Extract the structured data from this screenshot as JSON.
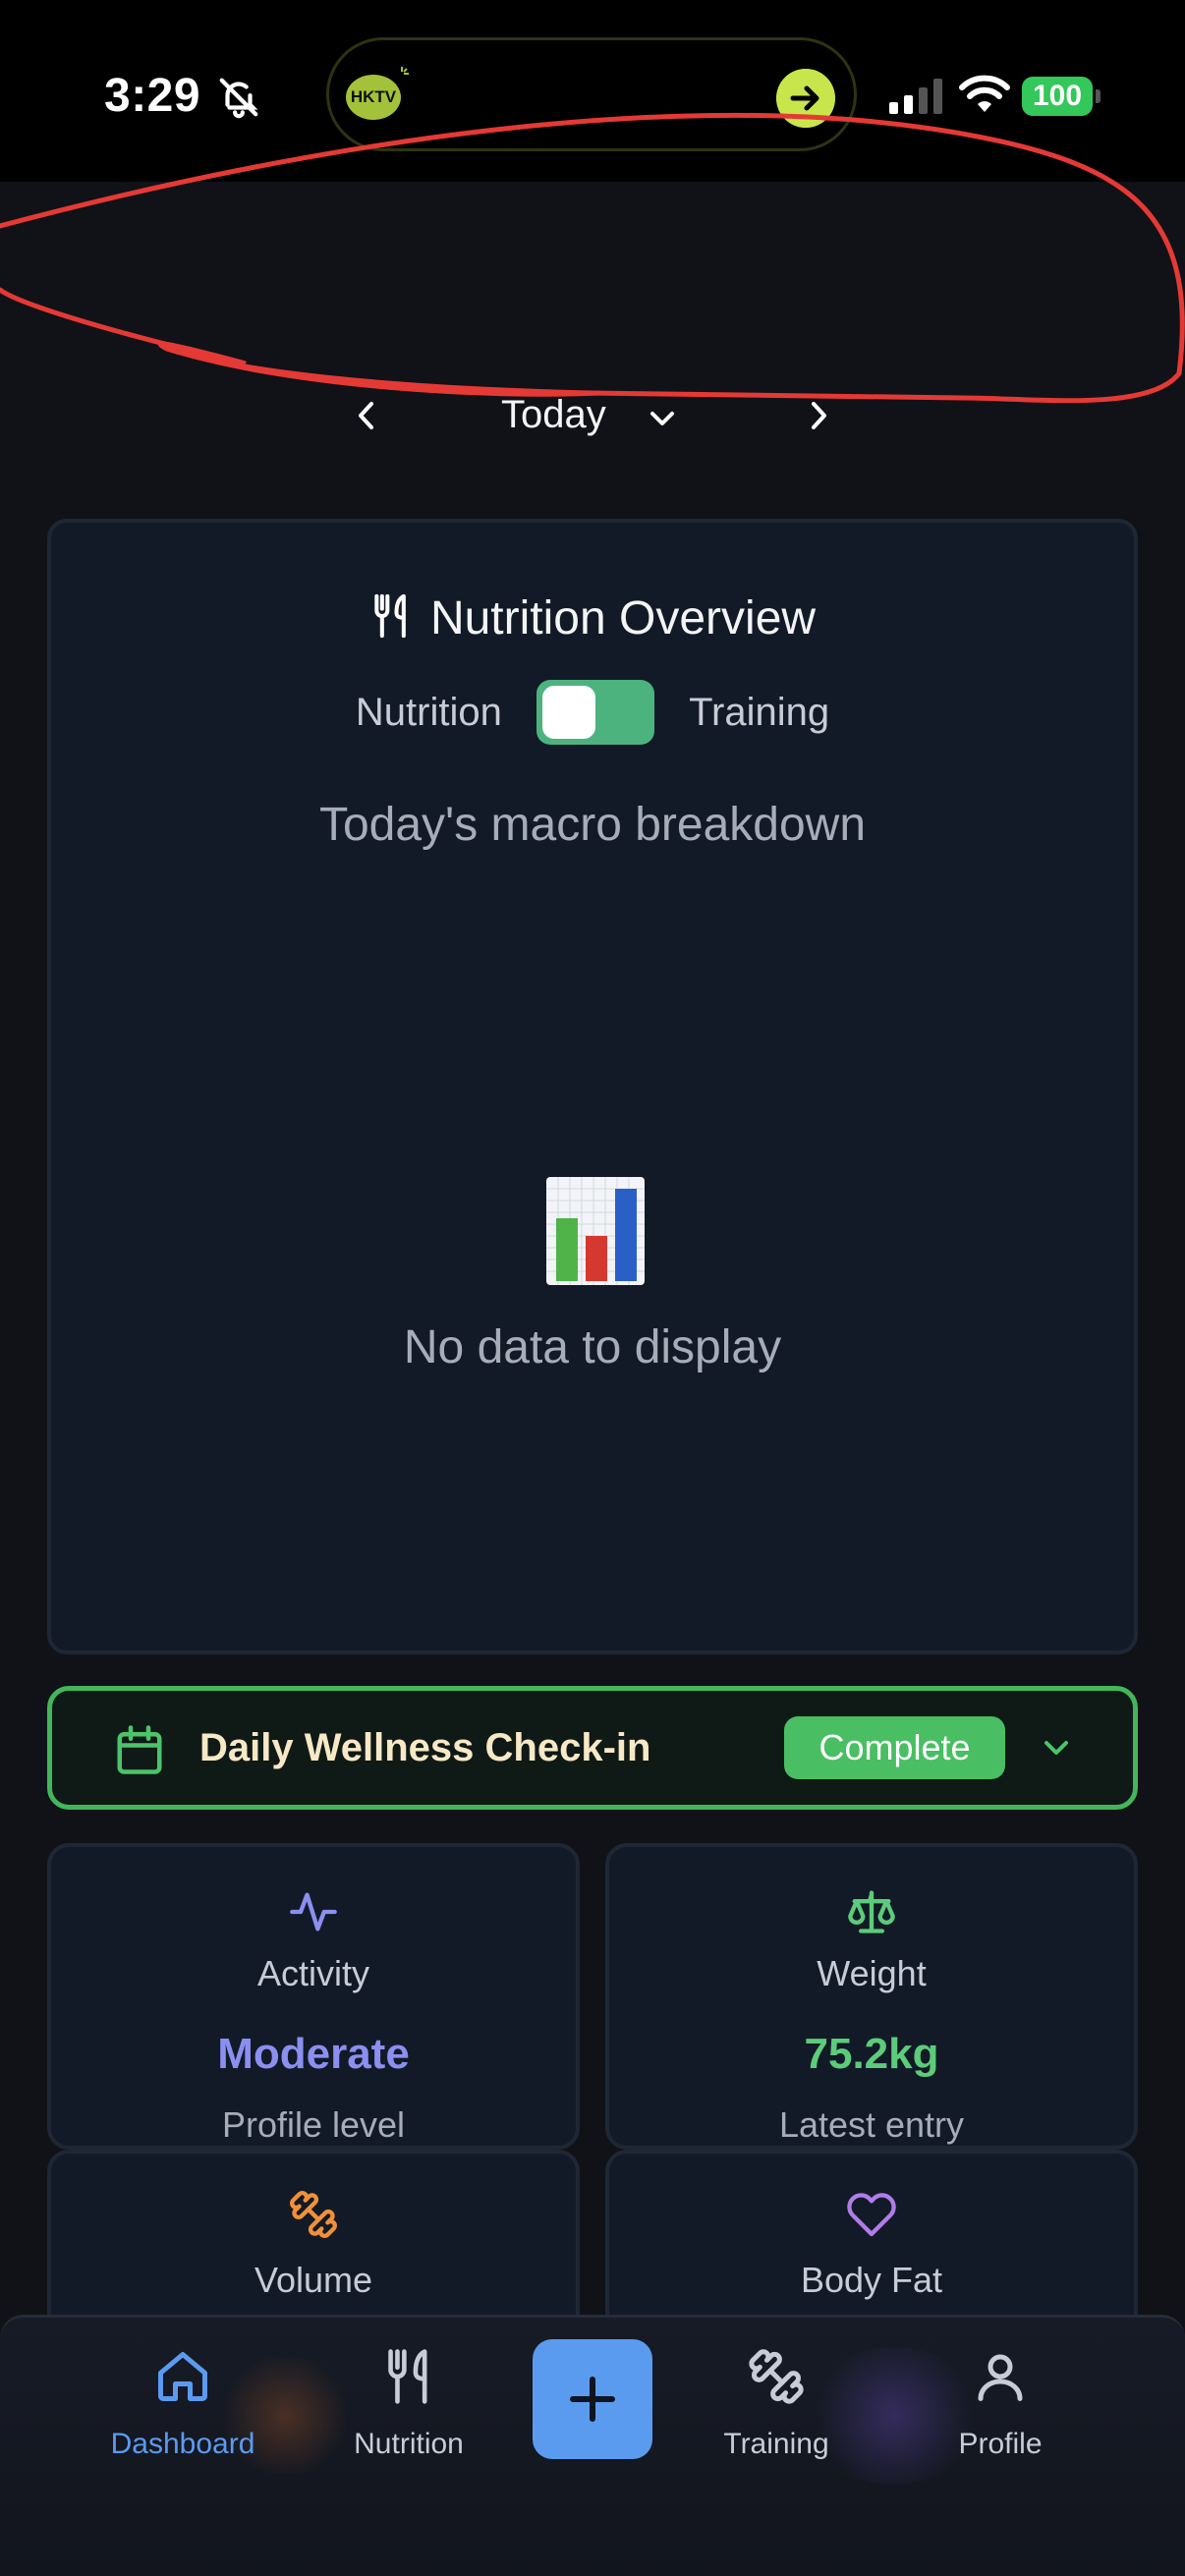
{
  "status_bar": {
    "time": "3:29",
    "island_app_badge": "HKTV",
    "battery": "100",
    "icons": [
      "bell-slash-icon",
      "arrow-right-circle-icon",
      "signal-icon",
      "wifi-icon",
      "battery-icon"
    ]
  },
  "date_nav": {
    "label": "Today"
  },
  "nutrition_card": {
    "title": "Nutrition Overview",
    "toggle_left_label": "Nutrition",
    "toggle_right_label": "Training",
    "subtitle": "Today's macro breakdown",
    "empty_text": "No data to display"
  },
  "wellness": {
    "title": "Daily Wellness Check-in",
    "status": "Complete",
    "colors": {
      "border": "#43b65a",
      "badge": "#49be62"
    }
  },
  "stats": [
    {
      "label": "Activity",
      "value": "Moderate",
      "sub": "Profile level",
      "color": "#8b8ff0",
      "icon": "activity-icon"
    },
    {
      "label": "Weight",
      "value": "75.2kg",
      "sub": "Latest entry",
      "color": "#5ccc7a",
      "icon": "scale-icon"
    },
    {
      "label": "Volume",
      "icon": "dumbbell-icon",
      "color": "#f0913a"
    },
    {
      "label": "Body Fat",
      "icon": "heart-icon",
      "color": "#b07ce8"
    }
  ],
  "bottom_nav": {
    "items": [
      {
        "label": "Dashboard",
        "icon": "home-icon",
        "active": true
      },
      {
        "label": "Nutrition",
        "icon": "utensils-icon",
        "active": false
      },
      {
        "label": "Training",
        "icon": "dumbbell-icon",
        "active": false
      },
      {
        "label": "Profile",
        "icon": "user-icon",
        "active": false
      }
    ],
    "add_icon": "plus-icon",
    "accent": "#5b9bef"
  }
}
